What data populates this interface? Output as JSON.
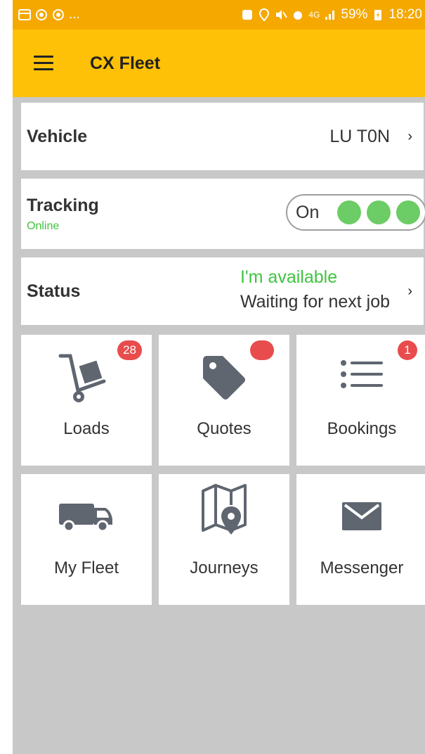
{
  "statusbar": {
    "left_ellipsis": "...",
    "network": "4G",
    "battery": "59%",
    "time": "18:20"
  },
  "appbar": {
    "title": "CX Fleet"
  },
  "vehicle": {
    "label": "Vehicle",
    "value": "LU T0N",
    "chevron": "›"
  },
  "tracking": {
    "label": "Tracking",
    "sub": "Online",
    "toggle_label": "On",
    "toggle_on": true
  },
  "status": {
    "label": "Status",
    "primary": "I'm available",
    "secondary": "Waiting for next job",
    "chevron": "›"
  },
  "tiles": [
    {
      "label": "Loads",
      "icon": "hand-truck-icon",
      "badge": "28"
    },
    {
      "label": "Quotes",
      "icon": "tag-icon",
      "badge": ""
    },
    {
      "label": "Bookings",
      "icon": "list-icon",
      "badge": "1"
    },
    {
      "label": "My Fleet",
      "icon": "truck-icon"
    },
    {
      "label": "Journeys",
      "icon": "map-pin-icon"
    },
    {
      "label": "Messenger",
      "icon": "envelope-icon"
    }
  ],
  "colors": {
    "statusbar": "#f5a800",
    "appbar": "#ffc107",
    "online_green": "#3fc43f",
    "toggle_dot": "#6ccc65",
    "badge": "#e84c4c",
    "icon_gray": "#5f6670",
    "background": "#c8c8c8"
  }
}
